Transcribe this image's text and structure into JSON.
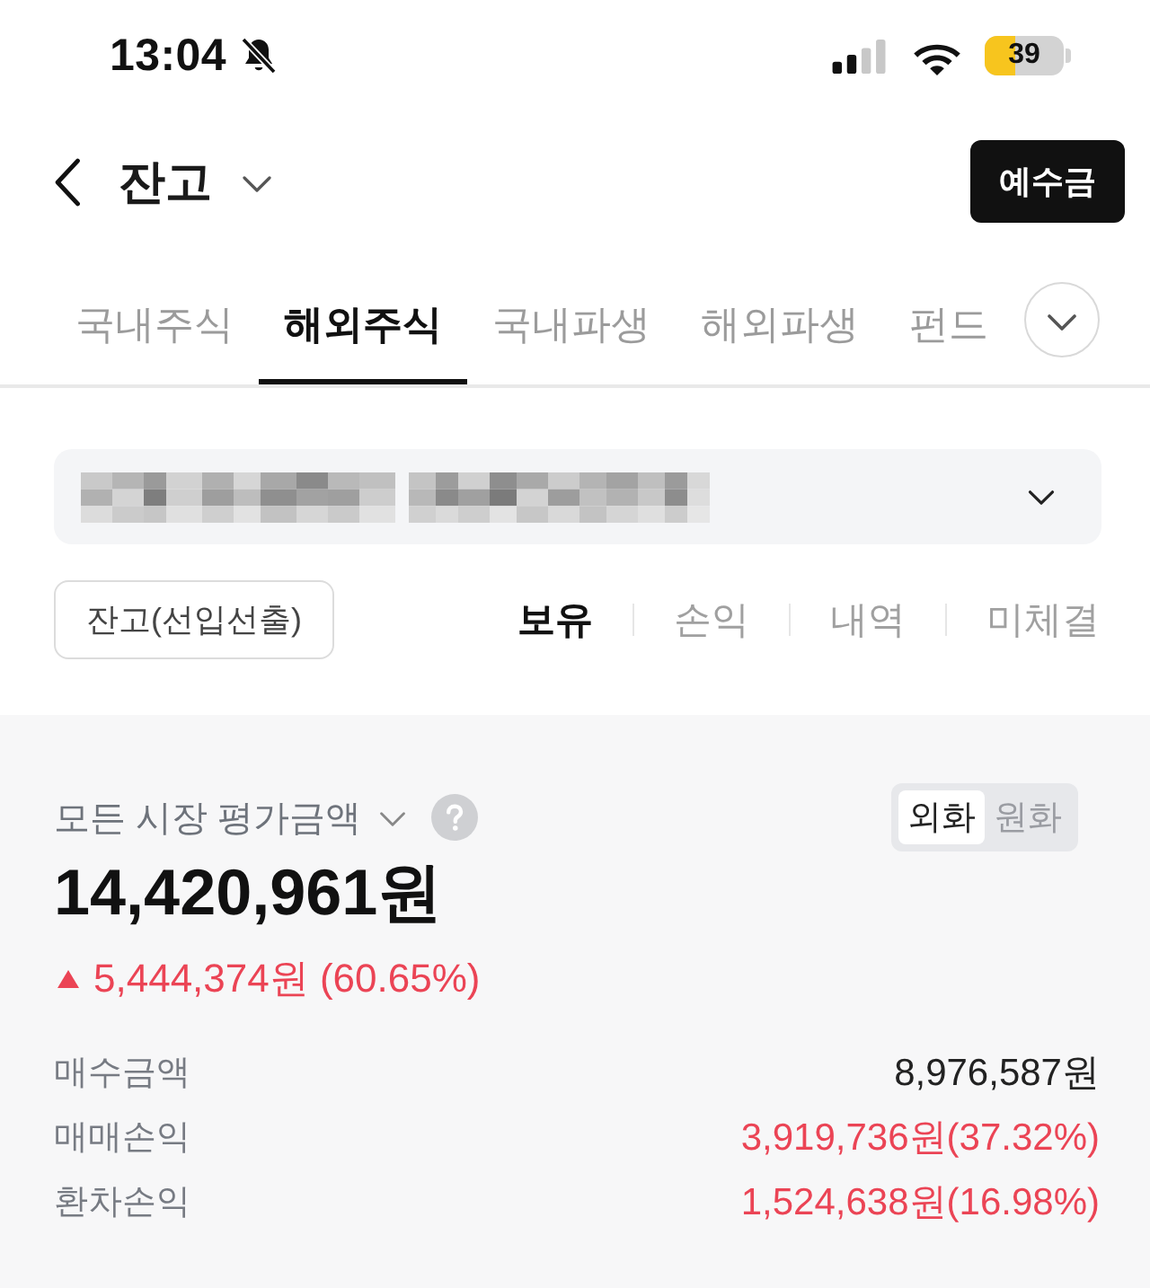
{
  "status_bar": {
    "time": "13:04",
    "battery": "39"
  },
  "header": {
    "title": "잔고",
    "deposit_button": "예수금"
  },
  "tabs": [
    {
      "label": "국내주식",
      "selected": false
    },
    {
      "label": "해외주식",
      "selected": true
    },
    {
      "label": "국내파생",
      "selected": false
    },
    {
      "label": "해외파생",
      "selected": false
    },
    {
      "label": "펀드",
      "selected": false
    }
  ],
  "filter_button": "잔고(선입선출)",
  "view_tabs": [
    {
      "label": "보유",
      "selected": true
    },
    {
      "label": "손익",
      "selected": false
    },
    {
      "label": "내역",
      "selected": false
    },
    {
      "label": "미체결",
      "selected": false
    }
  ],
  "summary": {
    "label": "모든 시장 평가금액",
    "currency_toggle": [
      {
        "label": "외화",
        "selected": true
      },
      {
        "label": "원화",
        "selected": false
      }
    ],
    "total": "14,420,961원",
    "change": {
      "rising": true,
      "text": "5,444,374원 (60.65%)"
    },
    "rows": [
      {
        "label": "매수금액",
        "value": "8,976,587원",
        "kind": "neutral"
      },
      {
        "label": "매매손익",
        "value": "3,919,736원(37.32%)",
        "kind": "gain"
      },
      {
        "label": "환차손익",
        "value": "1,524,638원(16.98%)",
        "kind": "gain"
      }
    ]
  }
}
